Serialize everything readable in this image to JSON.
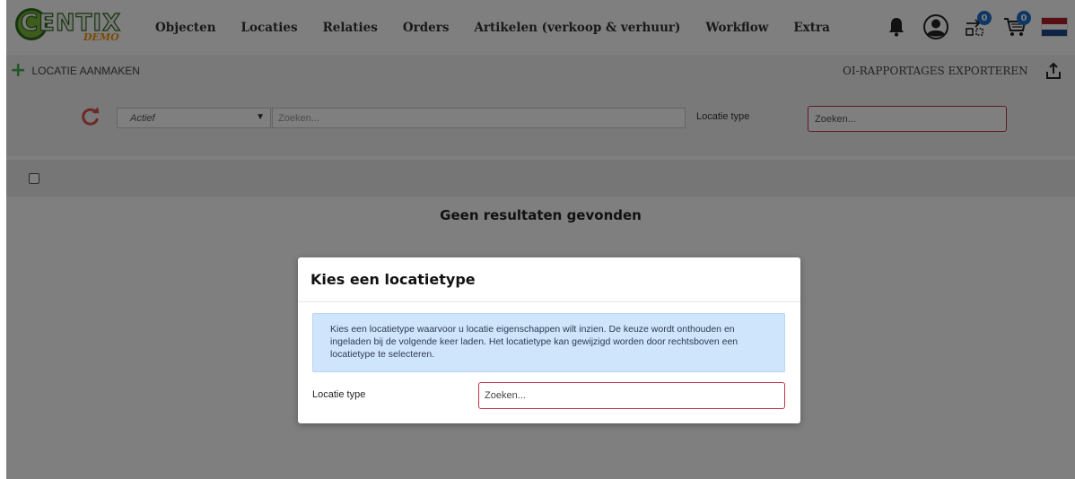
{
  "brand": {
    "name": "CENTIX",
    "tag": "DEMO"
  },
  "nav": {
    "items": [
      "Objecten",
      "Locaties",
      "Relaties",
      "Orders",
      "Artikelen (verkoop & verhuur)",
      "Workflow",
      "Extra"
    ],
    "notifications_badge": "0",
    "cart_badge": "0",
    "flag_colors": [
      "#ae1c28",
      "#ffffff",
      "#21468b"
    ]
  },
  "actions": {
    "create_label": "LOCATIE AANMAKEN",
    "export_label": "OI-RAPPORTAGES EXPORTEREN"
  },
  "filters": {
    "status_value": "Actief",
    "search_placeholder": "Zoeken...",
    "type_label": "Locatie type",
    "type_placeholder": "Zoeken..."
  },
  "results": {
    "empty_text": "Geen resultaten gevonden"
  },
  "modal": {
    "title": "Kies een locatietype",
    "info_line1": "Kies een locatietype waarvoor u locatie eigenschappen wilt inzien. De keuze wordt onthouden en",
    "info_line2": "ingeladen bij de volgende keer laden. Het locatietype kan gewijzigd worden door rechtsboven een",
    "info_line3": "locatietype te selecteren.",
    "field_label": "Locatie type",
    "field_placeholder": "Zoeken..."
  },
  "colors": {
    "accent_green": "#4caf50",
    "refresh_red": "#d9534f",
    "badge_blue": "#1e6ec8",
    "invalid_border": "#c3334a",
    "info_bg": "#cfe5fb"
  }
}
